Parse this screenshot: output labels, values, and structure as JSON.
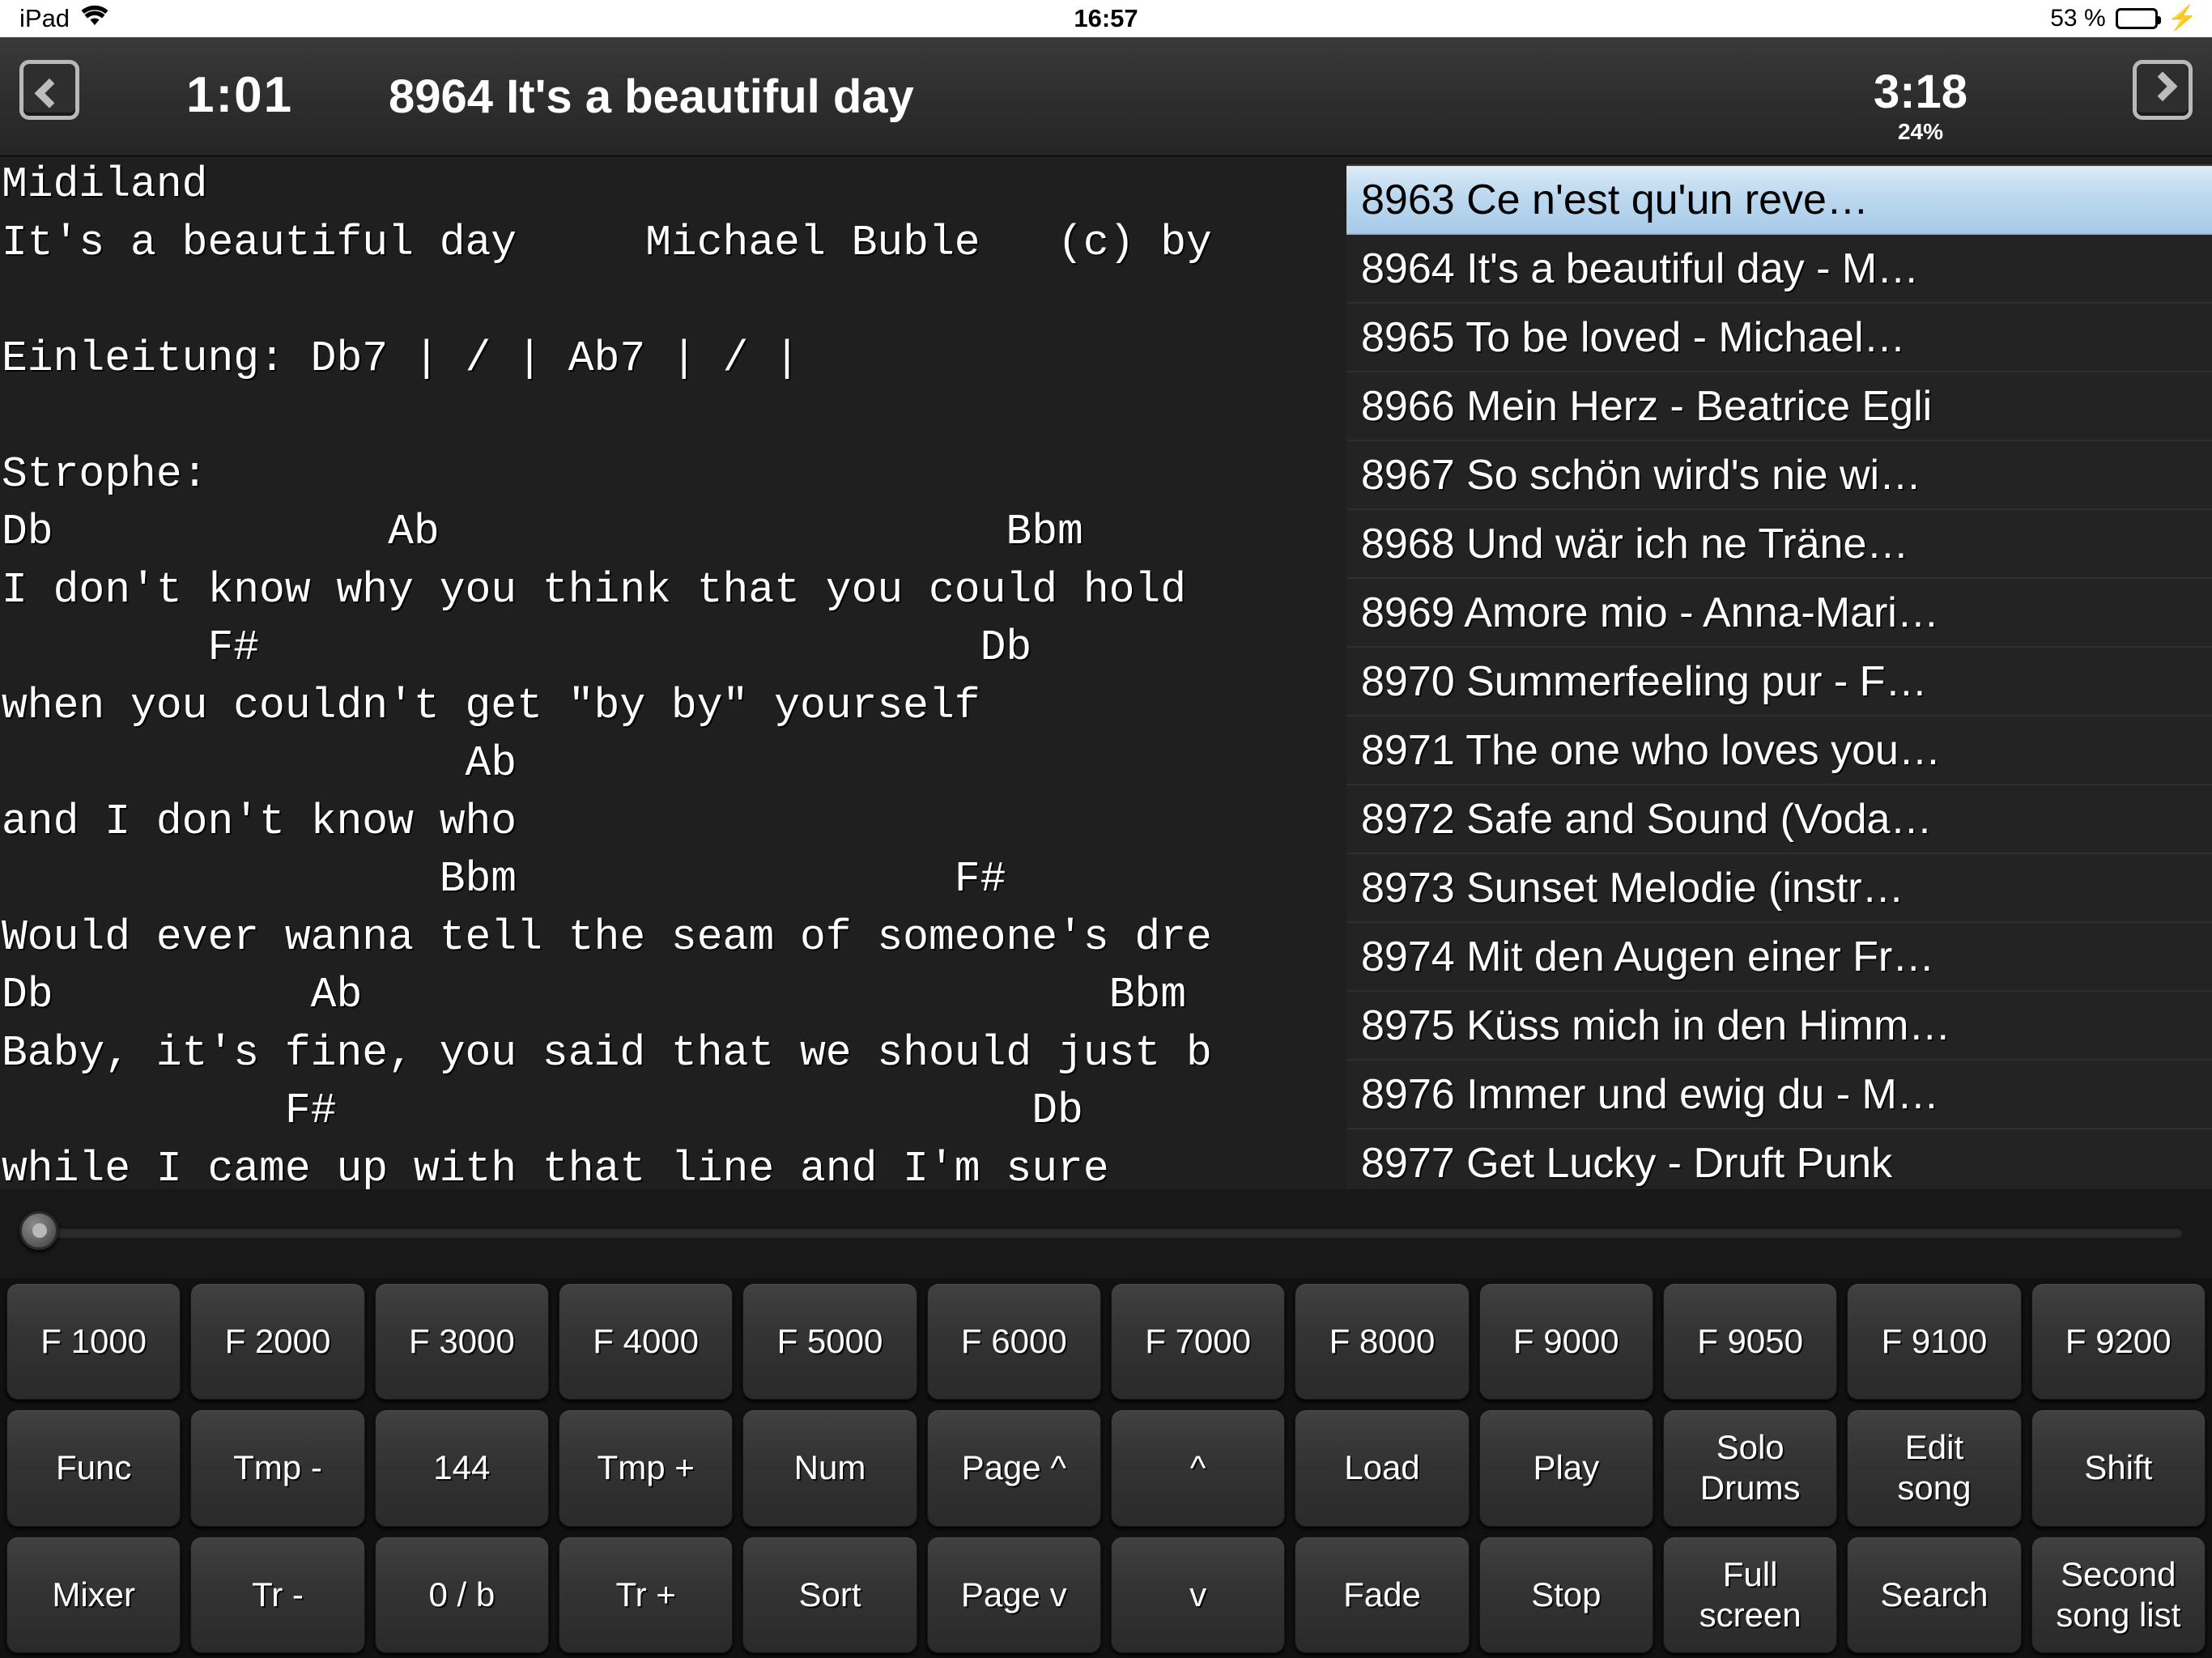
{
  "statusbar": {
    "device": "iPad",
    "wifi_icon": "wifi-icon",
    "time": "16:57",
    "battery_percent": "53 %",
    "battery_level": 53,
    "charging_icon": "lightning-bolt-icon"
  },
  "toolbar": {
    "prev_icon": "chevron-left-icon",
    "next_icon": "chevron-right-icon",
    "elapsed": "1:01",
    "title": "8964 It's a beautiful day",
    "remaining": "3:18",
    "remaining_percent": "24%",
    "beats": [
      {
        "state": "accent",
        "color": "#8f2d2d"
      },
      {
        "state": "on",
        "color": "#138313"
      },
      {
        "state": "on",
        "color": "#138313"
      },
      {
        "state": "on",
        "color": "#138313"
      }
    ]
  },
  "lyrics": {
    "text": "Midiland\nIt's a beautiful day     Michael Buble   (c) by\n\nEinleitung: Db7 | / | Ab7 | / |\n\nStrophe:\nDb             Ab                      Bbm\nI don't know why you think that you could hold\n        F#                            Db\nwhen you couldn't get \"by by\" yourself\n                  Ab\nand I don't know who\n                 Bbm                 F#\nWould ever wanna tell the seam of someone's dre\nDb          Ab                             Bbm\nBaby, it's fine, you said that we should just b\n           F#                           Db\nwhile I came up with that line and I'm sure"
  },
  "songlist": {
    "items": [
      {
        "label": "8963 Ce n'est qu'un reve…",
        "selected": true
      },
      {
        "label": "8964 It's a beautiful day - M…",
        "selected": false
      },
      {
        "label": "8965 To be loved - Michael…",
        "selected": false
      },
      {
        "label": "8966 Mein Herz - Beatrice Egli",
        "selected": false
      },
      {
        "label": "8967 So schön wird's nie wi…",
        "selected": false
      },
      {
        "label": "8968 Und wär ich ne Träne…",
        "selected": false
      },
      {
        "label": "8969 Amore mio - Anna-Mari…",
        "selected": false
      },
      {
        "label": "8970 Summerfeeling pur - F…",
        "selected": false
      },
      {
        "label": "8971 The one who loves you…",
        "selected": false
      },
      {
        "label": "8972 Safe and Sound (Voda…",
        "selected": false
      },
      {
        "label": "8973 Sunset Melodie (instr…",
        "selected": false
      },
      {
        "label": "8974 Mit den Augen einer Fr…",
        "selected": false
      },
      {
        "label": "8975 Küss mich in den Himm…",
        "selected": false
      },
      {
        "label": "8976 Immer und ewig du - M…",
        "selected": false
      },
      {
        "label": "8977 Get Lucky - Druft Punk",
        "selected": false
      }
    ]
  },
  "progress": {
    "value_percent": 1
  },
  "buttons": {
    "row1": [
      "F 1000",
      "F 2000",
      "F 3000",
      "F 4000",
      "F 5000",
      "F 6000",
      "F 7000",
      "F 8000",
      "F 9000",
      "F 9050",
      "F 9100",
      "F 9200"
    ],
    "row2": [
      "Func",
      "Tmp -",
      "144",
      "Tmp +",
      "Num",
      "Page ^",
      "^",
      "Load",
      "Play",
      "Solo\nDrums",
      "Edit\nsong",
      "Shift"
    ],
    "row3": [
      "Mixer",
      "Tr -",
      "0 / b",
      "Tr +",
      "Sort",
      "Page v",
      "v",
      "Fade",
      "Stop",
      "Full\nscreen",
      "Search",
      "Second\nsong list"
    ]
  }
}
